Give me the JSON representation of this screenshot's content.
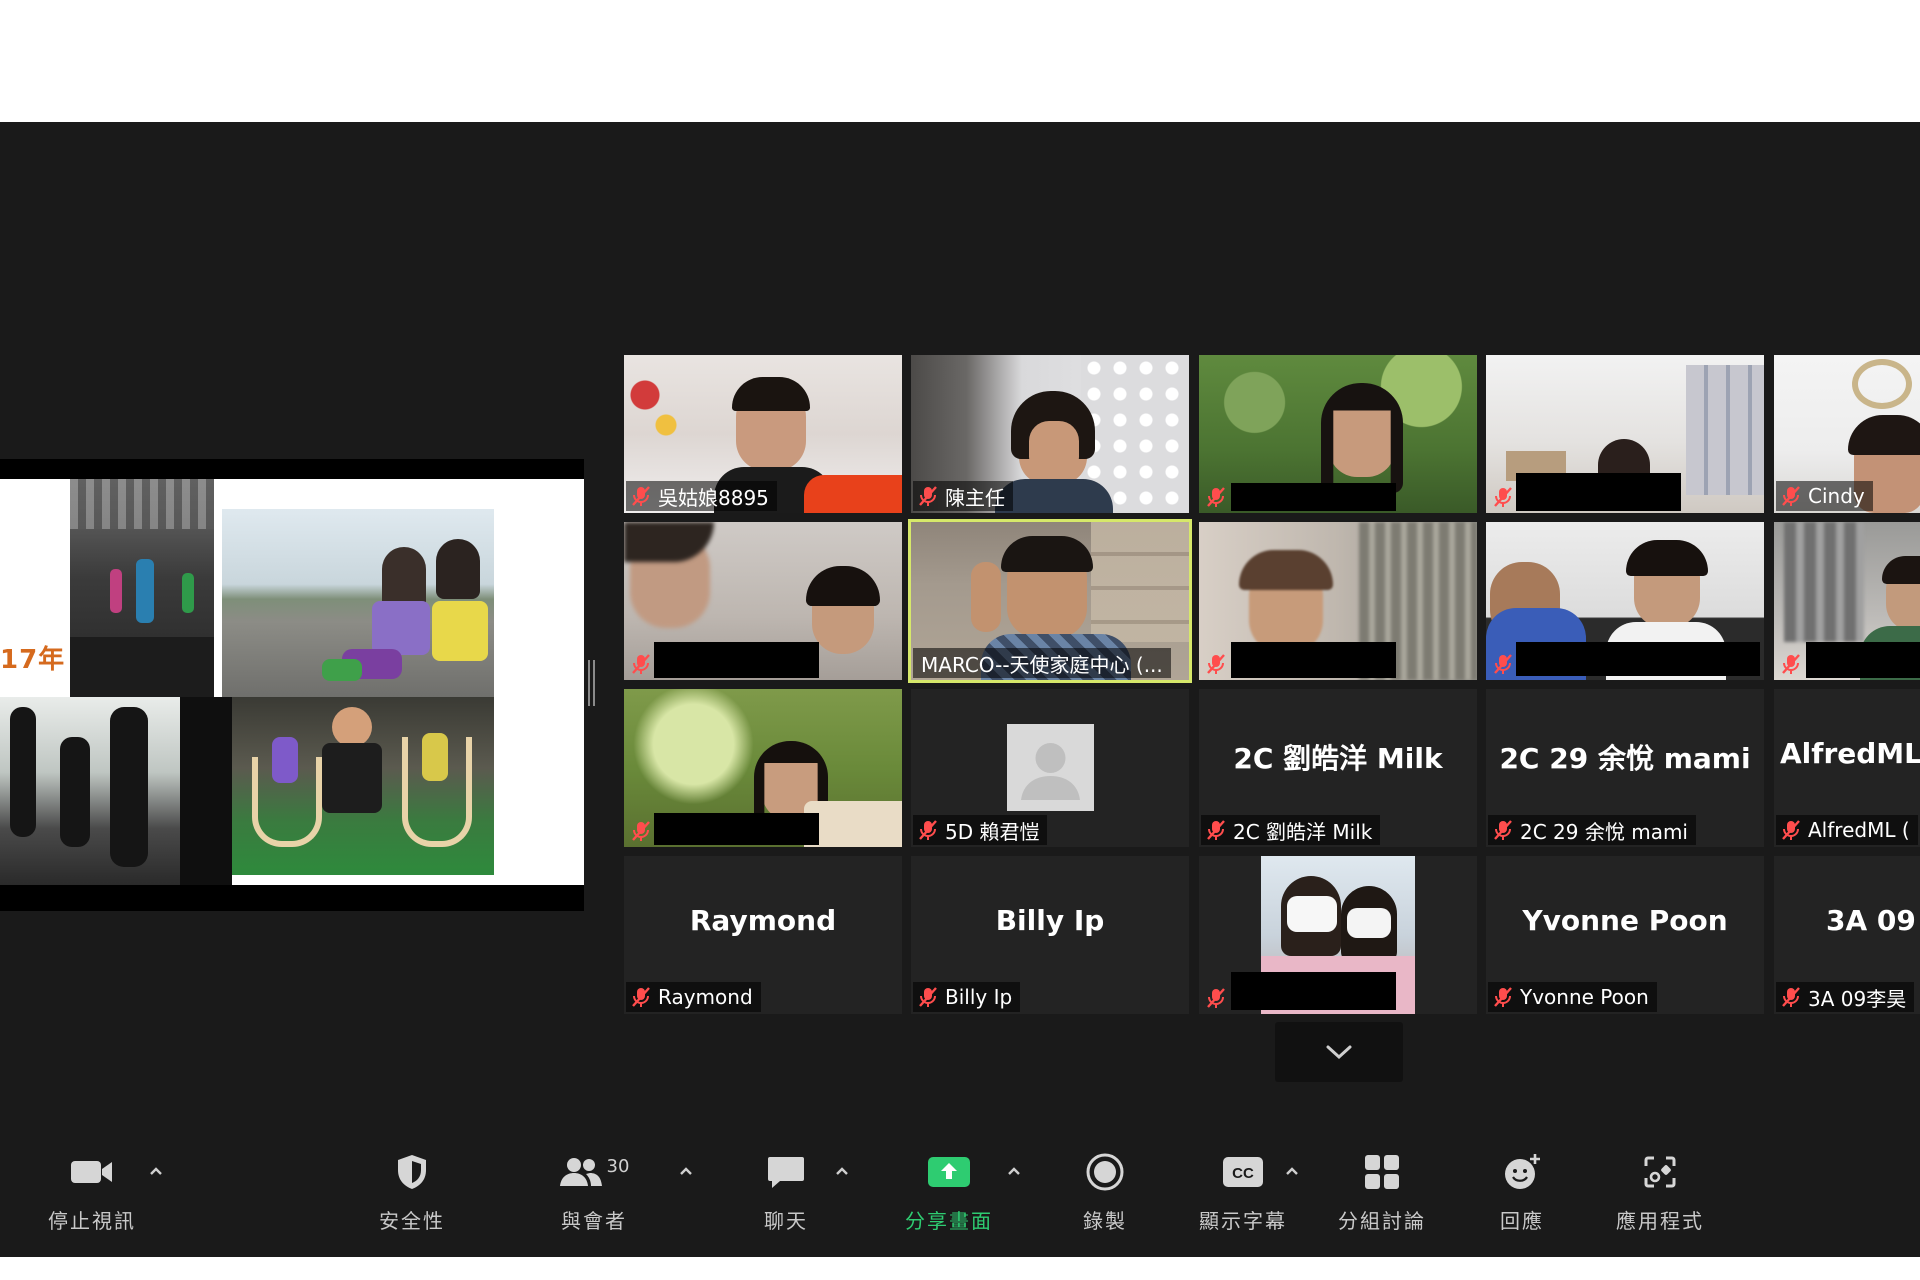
{
  "window": {
    "background": "#1a1a1a",
    "accent_green": "#2ecc71",
    "active_speaker_border": "#d6e86a"
  },
  "shared_screen": {
    "slide_text": "17年"
  },
  "gallery": {
    "tiles": [
      {
        "name": "吳姑娘8895",
        "type": "video",
        "muted": true
      },
      {
        "name": "陳主任",
        "type": "video",
        "muted": true
      },
      {
        "name": "",
        "type": "video",
        "muted": true,
        "redacted": true
      },
      {
        "name": "",
        "type": "video",
        "muted": true,
        "redacted": true
      },
      {
        "name": "Cindy",
        "type": "video",
        "muted": true
      },
      {
        "name": "",
        "type": "video",
        "muted": true,
        "redacted": true
      },
      {
        "name": "MARCO--天使家庭中心 (...",
        "type": "video",
        "muted": false,
        "active_speaker": true
      },
      {
        "name": "",
        "type": "video",
        "muted": true,
        "redacted": true
      },
      {
        "name": "",
        "type": "video",
        "muted": true,
        "redacted": true
      },
      {
        "name": "",
        "type": "video",
        "muted": true,
        "redacted": true
      },
      {
        "name": "",
        "type": "video",
        "muted": true,
        "redacted": true
      },
      {
        "name": "5D 賴君愷",
        "type": "avatar",
        "muted": true
      },
      {
        "name": "2C 劉皓洋 Milk",
        "display": "2C 劉皓洋 Milk",
        "type": "name",
        "muted": true
      },
      {
        "name": "2C 29 余悅 mami",
        "display": "2C 29 余悅 mami",
        "type": "name",
        "muted": true
      },
      {
        "name": "AlfredML (",
        "display": "AlfredML",
        "type": "name",
        "muted": true
      },
      {
        "name": "Raymond",
        "display": "Raymond",
        "type": "name",
        "muted": true
      },
      {
        "name": "Billy Ip",
        "display": "Billy Ip",
        "type": "name",
        "muted": true
      },
      {
        "name": "",
        "type": "photo",
        "muted": true,
        "redacted": true
      },
      {
        "name": "Yvonne Poon",
        "display": "Yvonne Poon",
        "type": "name",
        "muted": true
      },
      {
        "name": "3A 09李昊",
        "display": "3A 09",
        "type": "name",
        "muted": true
      }
    ],
    "down_icon": "chevron-down-icon"
  },
  "toolbar": {
    "stop_video": {
      "label": "停止視訊",
      "icon": "video-camera-icon"
    },
    "security": {
      "label": "安全性",
      "icon": "shield-icon"
    },
    "participants": {
      "label": "與會者",
      "icon": "participants-icon",
      "count": "30"
    },
    "chat": {
      "label": "聊天",
      "icon": "chat-bubble-icon"
    },
    "share_screen": {
      "label": "分享畫面",
      "icon": "share-screen-icon"
    },
    "record": {
      "label": "錄製",
      "icon": "record-icon"
    },
    "captions": {
      "label": "顯示字幕",
      "icon": "cc-icon"
    },
    "breakout": {
      "label": "分組討論",
      "icon": "breakout-rooms-icon"
    },
    "reactions": {
      "label": "回應",
      "icon": "reaction-emoji-icon"
    },
    "apps": {
      "label": "應用程式",
      "icon": "apps-icon"
    }
  }
}
